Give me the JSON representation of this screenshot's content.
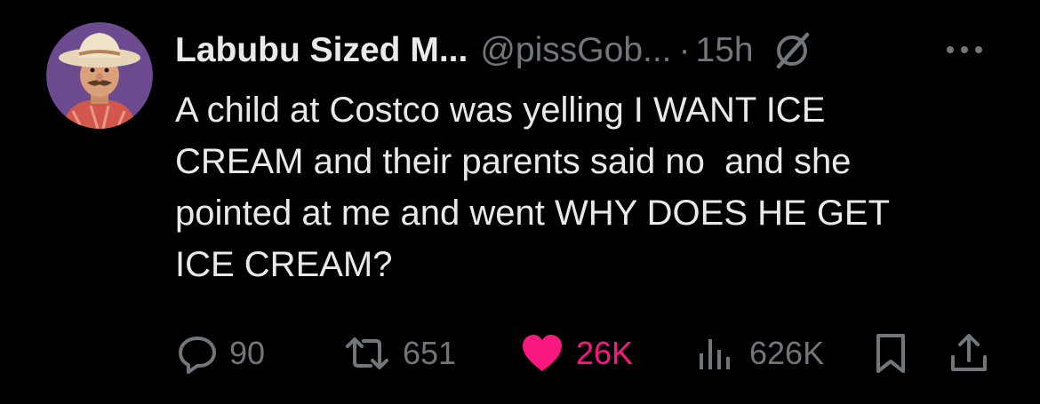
{
  "tweet": {
    "author": {
      "display_name": "Labubu Sized M...",
      "handle": "@pissGob...",
      "avatar_icon": "avatar-farmer-cartoon"
    },
    "separator": "·",
    "time": "15h",
    "grok_icon": "grok-icon",
    "more_icon": "more-icon",
    "text_lines": [
      "A child at Costco was yelling I WANT ICE",
      "CREAM and their parents said no  and she",
      "pointed at me and went WHY DOES HE GET",
      "ICE CREAM?"
    ]
  },
  "actions": {
    "reply": {
      "icon": "reply-icon",
      "count": "90"
    },
    "retweet": {
      "icon": "retweet-icon",
      "count": "651"
    },
    "like": {
      "icon": "heart-icon",
      "count": "26K",
      "liked": true
    },
    "views": {
      "icon": "views-icon",
      "count": "626K"
    },
    "bookmark": {
      "icon": "bookmark-icon"
    },
    "share": {
      "icon": "share-icon"
    }
  },
  "colors": {
    "background": "#000000",
    "primary_text": "#e7e9ea",
    "secondary_text": "#71767b",
    "like_pink": "#f91880",
    "avatar_bg": "#6b4a8f"
  }
}
